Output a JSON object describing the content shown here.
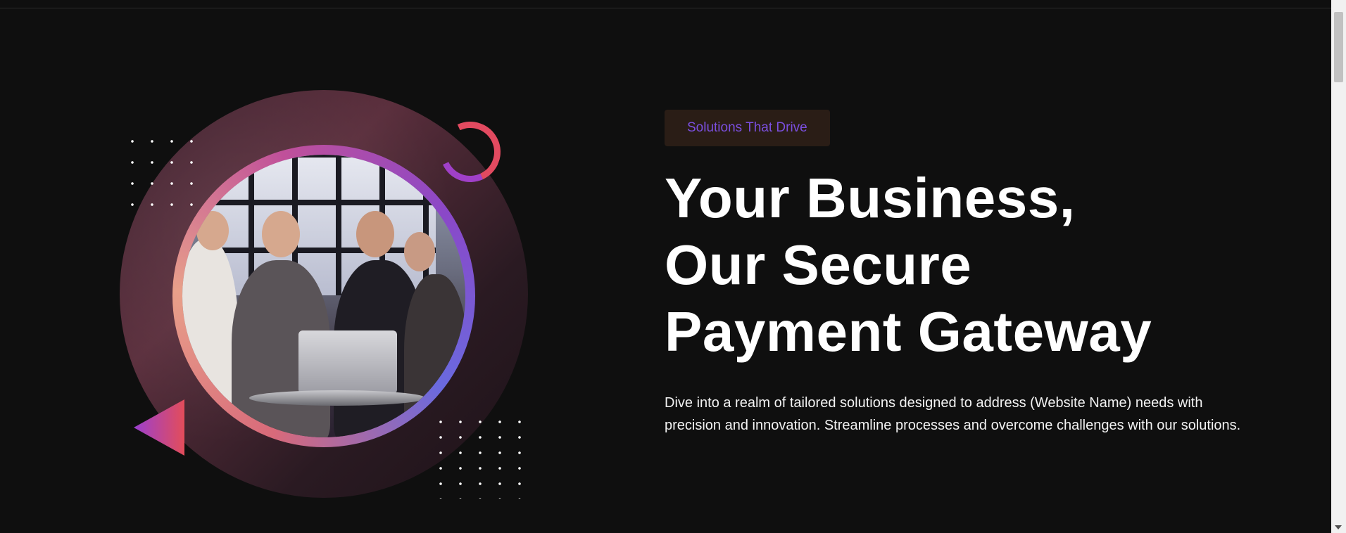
{
  "hero": {
    "badge": "Solutions That Drive",
    "headline": [
      "Your Business,",
      "Our Secure",
      "Payment Gateway"
    ],
    "description": "Dive into a realm of tailored solutions designed to address (Website Name) needs with precision and innovation. Streamline processes and overcome challenges with our solutions."
  },
  "colors": {
    "background": "#0f0f0f",
    "badge_text": "#7b4fe0",
    "badge_bg": "#2a1d16",
    "accent_red": "#e34d5a",
    "accent_purple": "#9a3fd0"
  },
  "icons": {
    "scroll_down": "chevron-down-icon"
  }
}
